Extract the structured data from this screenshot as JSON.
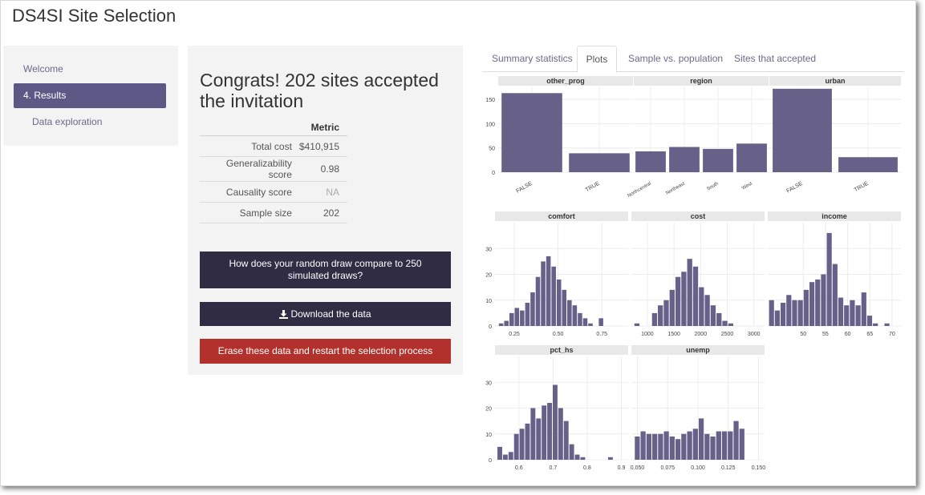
{
  "app": {
    "title": "DS4SI Site Selection"
  },
  "sidebar": {
    "items": [
      {
        "label": "Welcome",
        "active": false
      },
      {
        "label": "4. Results",
        "active": true
      },
      {
        "label": "Data exploration",
        "active": false
      }
    ]
  },
  "results": {
    "headline": "Congrats! 202 sites accepted the invitation",
    "table": {
      "header": "Metric",
      "rows": [
        {
          "label": "Total cost",
          "value": "$410,915"
        },
        {
          "label": "Generalizability score",
          "value": "0.98"
        },
        {
          "label": "Causality score",
          "value": "NA"
        },
        {
          "label": "Sample size",
          "value": "202"
        }
      ]
    },
    "buttons": {
      "compare": "How does your random draw compare to 250 simulated draws?",
      "download": "Download the data",
      "restart": "Erase these data and restart the selection process"
    }
  },
  "tabs": [
    {
      "label": "Summary statistics",
      "active": false
    },
    {
      "label": "Plots",
      "active": true
    },
    {
      "label": "Sample vs. population",
      "active": false
    },
    {
      "label": "Sites that accepted",
      "active": false
    }
  ],
  "colors": {
    "bar": "#676189",
    "strip": "#e8e8e8",
    "grid": "#ececec",
    "accent": "#5e5887",
    "dark_button": "#2f2c44",
    "red_button": "#b3312c"
  },
  "chart_data": [
    {
      "type": "bar",
      "title": "other_prog",
      "categories": [
        "FALSE",
        "TRUE"
      ],
      "values": [
        163,
        39
      ],
      "ylim": [
        0,
        175
      ],
      "yticks": [
        0,
        50,
        100,
        150
      ]
    },
    {
      "type": "bar",
      "title": "region",
      "categories": [
        "Northcentral",
        "Northeast",
        "South",
        "West"
      ],
      "values": [
        43,
        52,
        48,
        59
      ],
      "ylim": [
        0,
        175
      ],
      "yticks": [
        0,
        50,
        100,
        150
      ]
    },
    {
      "type": "bar",
      "title": "urban",
      "categories": [
        "FALSE",
        "TRUE"
      ],
      "values": [
        172,
        31
      ],
      "ylim": [
        0,
        175
      ],
      "yticks": [
        0,
        50,
        100,
        150
      ]
    },
    {
      "type": "histogram",
      "title": "comfort",
      "xlim": [
        0.14,
        0.9
      ],
      "ylim": [
        0,
        40
      ],
      "xticks": [
        "0.25",
        "0.50",
        "0.75"
      ],
      "xtick_values": [
        0.25,
        0.5,
        0.75
      ],
      "yticks": [
        0,
        10,
        20,
        30
      ],
      "bin_start": 0.16,
      "bin_width": 0.03,
      "counts": [
        1,
        2,
        5,
        7,
        6,
        9,
        13,
        19,
        25,
        27,
        23,
        18,
        14,
        10,
        8,
        5,
        3,
        1,
        0,
        3
      ]
    },
    {
      "type": "histogram",
      "title": "cost",
      "xlim": [
        700,
        3200
      ],
      "ylim": [
        0,
        40
      ],
      "xticks": [
        "1000",
        "1500",
        "2000",
        "2500",
        "3000"
      ],
      "xtick_values": [
        1000,
        1500,
        2000,
        2500,
        3000
      ],
      "yticks": [
        0,
        10,
        20,
        30
      ],
      "bin_start": 750,
      "bin_width": 110,
      "counts": [
        1,
        0,
        0,
        5,
        8,
        10,
        14,
        19,
        21,
        26,
        23,
        15,
        12,
        8,
        5,
        2,
        1
      ]
    },
    {
      "type": "histogram",
      "title": "income",
      "xlim": [
        42,
        72
      ],
      "ylim": [
        0,
        40
      ],
      "xticks": [
        "50",
        "55",
        "60",
        "65",
        "70"
      ],
      "xtick_values": [
        50,
        55,
        60,
        65,
        70
      ],
      "yticks": [
        0,
        10,
        20,
        30
      ],
      "bin_start": 42.2,
      "bin_width": 1.3,
      "counts": [
        10,
        6,
        9,
        12,
        10,
        10,
        14,
        17,
        18,
        20,
        36,
        24,
        11,
        8,
        10,
        8,
        13,
        4,
        1,
        0,
        1
      ]
    },
    {
      "type": "histogram",
      "title": "pct_hs",
      "xlim": [
        0.53,
        0.92
      ],
      "ylim": [
        0,
        40
      ],
      "xticks": [
        "0.6",
        "0.7",
        "0.8",
        "0.9"
      ],
      "xtick_values": [
        0.6,
        0.7,
        0.8,
        0.9
      ],
      "yticks": [
        0,
        10,
        20,
        30
      ],
      "bin_start": 0.536,
      "bin_width": 0.0162,
      "counts": [
        5,
        2,
        3,
        10,
        12,
        14,
        20,
        16,
        21,
        22,
        29,
        20,
        15,
        6,
        2,
        1,
        0,
        0,
        0,
        0,
        1
      ]
    },
    {
      "type": "histogram",
      "title": "unemp",
      "xlim": [
        0.045,
        0.155
      ],
      "ylim": [
        0,
        40
      ],
      "xticks": [
        "0.050",
        "0.075",
        "0.100",
        "0.125",
        "0.150"
      ],
      "xtick_values": [
        0.05,
        0.075,
        0.1,
        0.125,
        0.15
      ],
      "yticks": [
        0,
        10,
        20,
        30
      ],
      "bin_start": 0.0475,
      "bin_width": 0.0048,
      "counts": [
        9,
        11,
        10,
        10,
        10,
        11,
        9,
        8,
        10,
        11,
        12,
        16,
        10,
        9,
        11,
        11,
        11,
        15,
        12
      ]
    }
  ]
}
